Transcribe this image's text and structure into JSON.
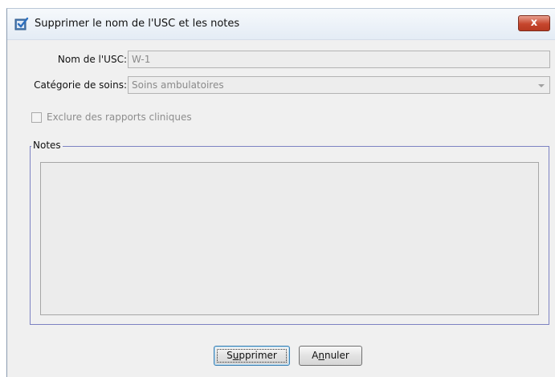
{
  "dialog": {
    "title": "Supprimer le nom de l'USC et les notes",
    "close_label": "x"
  },
  "form": {
    "usc_name_label": "Nom de l'USC:",
    "usc_name_value": "W-1",
    "care_category_label": "Catégorie de soins:",
    "care_category_value": "Soins ambulatoires",
    "exclude_label": "Exclure des rapports cliniques",
    "exclude_checked": false
  },
  "notes": {
    "legend": "Notes",
    "value": ""
  },
  "buttons": {
    "delete_pre": "S",
    "delete_mnemonic": "u",
    "delete_post": "pprimer",
    "cancel_pre": "A",
    "cancel_mnemonic": "n",
    "cancel_post": "nuler"
  },
  "colors": {
    "accent": "#3c7fb1",
    "close": "#c6462d"
  }
}
